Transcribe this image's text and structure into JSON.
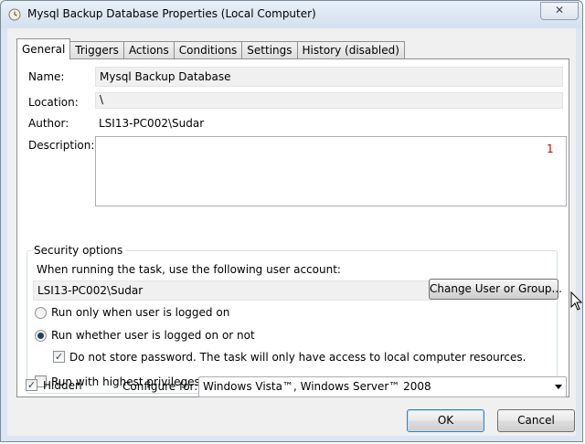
{
  "window": {
    "title": "Mysql Backup Database Properties (Local Computer)",
    "close_label": "✕",
    "icon": "clock-icon"
  },
  "tabs": [
    {
      "label": "General",
      "active": true
    },
    {
      "label": "Triggers"
    },
    {
      "label": "Actions"
    },
    {
      "label": "Conditions"
    },
    {
      "label": "Settings"
    },
    {
      "label": "History (disabled)"
    }
  ],
  "general": {
    "name_label": "Name:",
    "name_value": "Mysql Backup Database",
    "location_label": "Location:",
    "location_value": "\\",
    "author_label": "Author:",
    "author_value": "LSI13-PC002\\Sudar",
    "description_label": "Description:",
    "description_marker": "1"
  },
  "security": {
    "legend": "Security options",
    "account_prompt": "When running the task, use the following user account:",
    "account_value": "LSI13-PC002\\Sudar",
    "change_button": "Change User or Group...",
    "run_logged_on": "Run only when user is logged on",
    "run_whether": "Run whether user is logged on or not",
    "do_not_store": "Do not store password.  The task will only have access to local computer resources.",
    "highest_privileges": "Run with highest privileges",
    "selected_option": "run_whether",
    "do_not_store_checked": true,
    "highest_privileges_checked": false
  },
  "footer": {
    "hidden_label": "Hidden",
    "hidden_checked": true,
    "configure_label": "Configure for:",
    "configure_value": "Windows Vista™, Windows Server™ 2008",
    "ok_button": "OK",
    "cancel_button": "Cancel"
  }
}
